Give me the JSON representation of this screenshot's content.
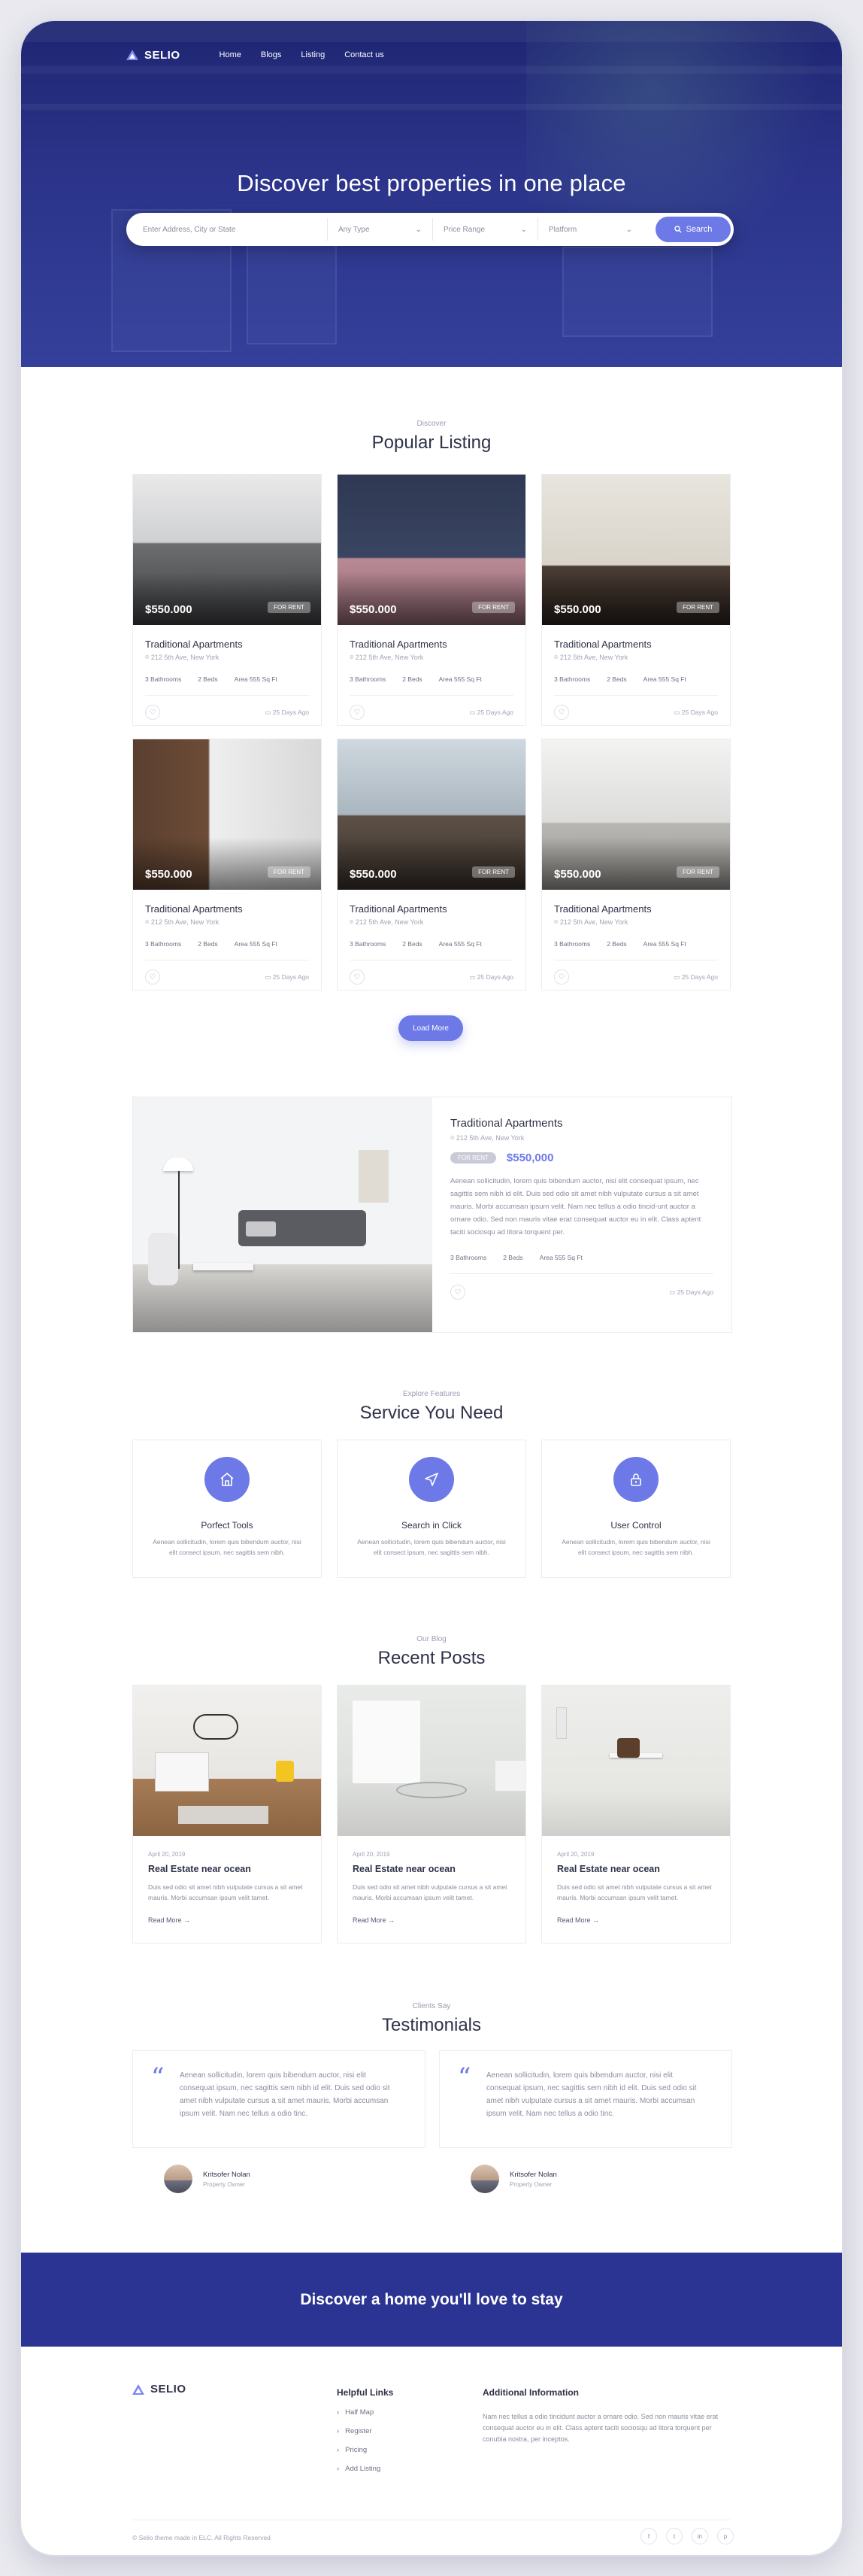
{
  "brand": {
    "name": "SELIO"
  },
  "nav": {
    "items": [
      "Home",
      "Blogs",
      "Listing",
      "Contact us"
    ]
  },
  "hero": {
    "title": "Discover best properties in one place"
  },
  "search": {
    "placeholder": "Enter Address, City or State",
    "type_label": "Any Type",
    "price_label": "Price Range",
    "platform_label": "Platform",
    "button_label": "Search"
  },
  "listing": {
    "eyebrow": "Discover",
    "title": "Popular Listing",
    "cards": [
      {
        "price": "$550.000",
        "tag": "FOR RENT",
        "title": "Traditional Apartments",
        "address": "212 5th Ave, New York",
        "baths": "3 Bathrooms",
        "beds": "2 Beds",
        "area": "Area 555 Sq Ft",
        "days": "25 Days Ago"
      },
      {
        "price": "$550.000",
        "tag": "FOR RENT",
        "title": "Traditional Apartments",
        "address": "212 5th Ave, New York",
        "baths": "3 Bathrooms",
        "beds": "2 Beds",
        "area": "Area 555 Sq Ft",
        "days": "25 Days Ago"
      },
      {
        "price": "$550.000",
        "tag": "FOR RENT",
        "title": "Traditional Apartments",
        "address": "212 5th Ave, New York",
        "baths": "3 Bathrooms",
        "beds": "2 Beds",
        "area": "Area 555 Sq Ft",
        "days": "25 Days Ago"
      },
      {
        "price": "$550.000",
        "tag": "FOR RENT",
        "title": "Traditional Apartments",
        "address": "212 5th Ave, New York",
        "baths": "3 Bathrooms",
        "beds": "2 Beds",
        "area": "Area 555 Sq Ft",
        "days": "25 Days Ago"
      },
      {
        "price": "$550.000",
        "tag": "FOR RENT",
        "title": "Traditional Apartments",
        "address": "212 5th Ave, New York",
        "baths": "3 Bathrooms",
        "beds": "2 Beds",
        "area": "Area 555 Sq Ft",
        "days": "25 Days Ago"
      },
      {
        "price": "$550.000",
        "tag": "FOR RENT",
        "title": "Traditional Apartments",
        "address": "212 5th Ave, New York",
        "baths": "3 Bathrooms",
        "beds": "2 Beds",
        "area": "Area 555 Sq Ft",
        "days": "25 Days Ago"
      }
    ],
    "load_more": "Load More"
  },
  "featured": {
    "title": "Traditional Apartments",
    "address": "212 5th Ave, New York",
    "tag": "FOR RENT",
    "price": "$550,000",
    "description": "Aenean sollicitudin, lorem quis bibendum auctor, nisi elit consequat ipsum, nec sagittis sem nibh id elit. Duis sed odio sit amet nibh vulputate cursus a sit amet mauris. Morbi accumsan ipsum velit. Nam nec tellus a odio tincid-unt auctor a ornare odio. Sed non mauris vitae erat consequat auctor eu in elit. Class aptent taciti sociosqu ad litora torquent per.",
    "baths": "3 Bathrooms",
    "beds": "2 Beds",
    "area": "Area 555 Sq Ft",
    "days": "25 Days Ago"
  },
  "services": {
    "eyebrow": "Explore Features",
    "title": "Service You Need",
    "items": [
      {
        "icon": "home-icon",
        "title": "Porfect Tools",
        "text": "Aenean sollicitudin, lorem quis bibendum auctor, nisi elit consect ipsum, nec sagittis sem nibh."
      },
      {
        "icon": "send-icon",
        "title": "Search in Click",
        "text": "Aenean sollicitudin, lorem quis bibendum auctor, nisi elit consect ipsum, nec sagittis sem nibh."
      },
      {
        "icon": "lock-icon",
        "title": "User Control",
        "text": "Aenean sollicitudin, lorem quis bibendum auctor, nisi elit consect ipsum, nec sagittis sem nibh."
      }
    ]
  },
  "posts": {
    "eyebrow": "Our Blog",
    "title": "Recent Posts",
    "items": [
      {
        "date": "April 20, 2019",
        "title": "Real Estate near ocean",
        "text": "Duis sed odio sit amet nibh vulputate cursus a sit amet mauris. Morbi accumsan ipsum velit tamet.",
        "more": "Read More"
      },
      {
        "date": "April 20, 2019",
        "title": "Real Estate near ocean",
        "text": "Duis sed odio sit amet nibh vulputate cursus a sit amet mauris. Morbi accumsan ipsum velit tamet.",
        "more": "Read More"
      },
      {
        "date": "April 20, 2019",
        "title": "Real Estate near ocean",
        "text": "Duis sed odio sit amet nibh vulputate cursus a sit amet mauris. Morbi accumsan ipsum velit tamet.",
        "more": "Read More"
      }
    ]
  },
  "testimonials": {
    "eyebrow": "Clients Say",
    "title": "Testimonials",
    "items": [
      {
        "text": "Aenean sollicitudin, lorem quis bibendum auctor, nisi elit consequat ipsum, nec sagittis sem nibh id elit. Duis sed odio sit amet nibh vulputate cursus a sit amet mauris. Morbi accumsan ipsum velit. Nam nec tellus a odio tinc.",
        "name": "Kritsofer Nolan",
        "role": "Property Owner"
      },
      {
        "text": "Aenean sollicitudin, lorem quis bibendum auctor, nisi elit consequat ipsum, nec sagittis sem nibh id elit. Duis sed odio sit amet nibh vulputate cursus a sit amet mauris. Morbi accumsan ipsum velit. Nam nec tellus a odio tinc.",
        "name": "Kritsofer Nolan",
        "role": "Property Owner"
      }
    ]
  },
  "cta": {
    "title": "Discover a home you'll love to stay"
  },
  "footer": {
    "links_title": "Helpful Links",
    "links": [
      "Half Map",
      "Register",
      "Pricing",
      "Add Listing"
    ],
    "info_title": "Additional Information",
    "info_text": "Nam nec tellus a odio tincidunt auctor a ornare odio. Sed non mauris vitae erat consequat auctor eu in elit. Class aptent taciti sociosqu ad litora torquent per conubia nostra, per inceptos.",
    "copyright": "© Selio theme made in ELC. All Rights Reserved",
    "social": [
      "f",
      "t",
      "in",
      "p"
    ]
  },
  "colors": {
    "primary": "#6c79e6",
    "hero_dark": "#1e2672",
    "cta": "#2b3492"
  }
}
